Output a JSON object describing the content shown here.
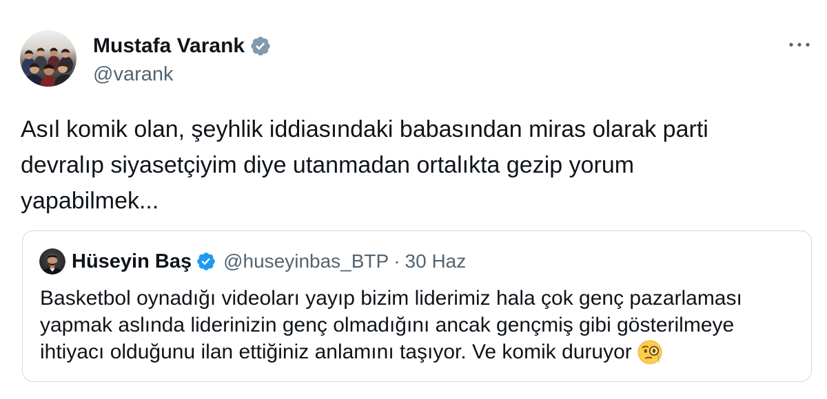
{
  "colors": {
    "background": "#ffffff",
    "text": "#0f1419",
    "secondary": "#536471",
    "border": "#cfd9de",
    "badge_author": "#829aab",
    "badge_quoted": "#1d9bf0",
    "badge_check": "#ffffff",
    "more_icon": "#536471"
  },
  "icons": {
    "verified": "verified-badge-icon",
    "more": "more-options-icon",
    "emoji": "face-with-monocle-icon"
  },
  "tweet": {
    "author": {
      "name": "Mustafa Varank",
      "handle": "@varank"
    },
    "text_lines": [
      "Asıl komik olan, şeyhlik iddiasındaki babasından miras olarak parti",
      "devralıp siyasetçiyim diye utanmadan ortalıkta gezip yorum",
      "yapabilmek..."
    ],
    "quoted": {
      "author": {
        "name": "Hüseyin Baş",
        "handle": "@huseyinbas_BTP"
      },
      "separator": "·",
      "date": "30 Haz",
      "text_lines": [
        "Basketbol oynadığı videoları yayıp bizim liderimiz hala çok genç pazarlaması",
        "yapmak aslında liderinizin genç olmadığını ancak gençmiş gibi gösterilmeye",
        "ihtiyacı olduğunu ilan ettiğiniz anlamını taşıyor. Ve komik duruyor"
      ],
      "trailing_icon": "face-with-monocle-icon"
    }
  }
}
